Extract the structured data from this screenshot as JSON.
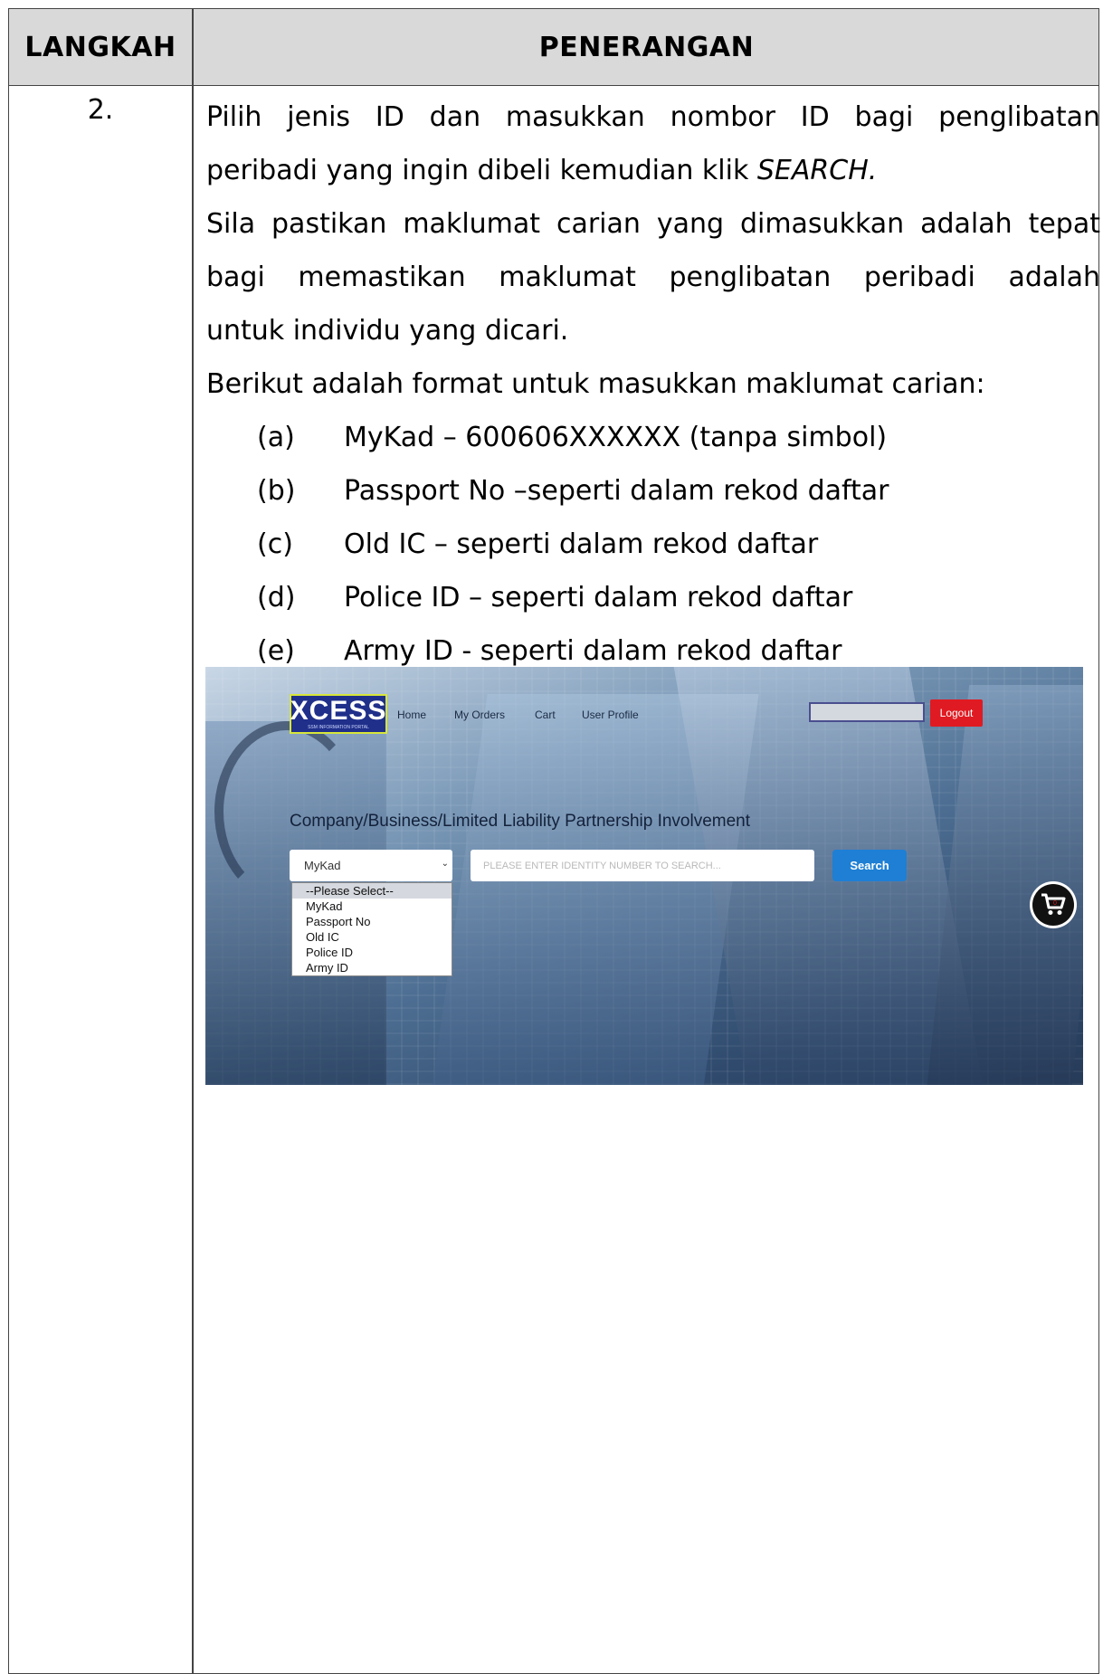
{
  "table": {
    "header": {
      "langkah": "LANGKAH",
      "penerangan": "PENERANGAN"
    },
    "step_number": "2.",
    "paragraphs": {
      "p1_line1": "Pilih jenis ID dan masukkan nombor ID bagi penglibatan",
      "p1_line2_prefix": "peribadi yang ingin dibeli kemudian klik ",
      "p1_line2_emph": "SEARCH.",
      "p2_line1": "Sila pastikan maklumat carian yang dimasukkan adalah tepat",
      "p2_line2": "bagi memastikan maklumat penglibatan peribadi adalah",
      "p2_line3": "untuk individu yang dicari.",
      "p3": "Berikut adalah format untuk masukkan maklumat carian:"
    },
    "list": [
      {
        "label": "(a)",
        "text": "MyKad – 600606XXXXXX (tanpa simbol)"
      },
      {
        "label": "(b)",
        "text": "Passport No –seperti dalam rekod daftar"
      },
      {
        "label": "(c)",
        "text": "Old IC – seperti dalam rekod daftar"
      },
      {
        "label": "(d)",
        "text": "Police ID – seperti dalam rekod daftar"
      },
      {
        "label": "(e)",
        "text": "Army ID - seperti dalam rekod daftar"
      }
    ]
  },
  "screenshot": {
    "logo": {
      "text": "XCESS",
      "subtext": "SSM INFORMATION PORTAL"
    },
    "nav": {
      "home": "Home",
      "orders": "My Orders",
      "cart": "Cart",
      "profile": "User Profile"
    },
    "logout_label": "Logout",
    "section_title": "Company/Business/Limited Liability Partnership Involvement",
    "id_type_selected": "MyKad",
    "search_placeholder": "PLEASE ENTER IDENTITY NUMBER TO SEARCH...",
    "search_label": "Search",
    "dropdown_options": [
      "--Please Select--",
      "MyKad",
      "Passport No",
      "Old IC",
      "Police ID",
      "Army ID"
    ],
    "cart_count": "0",
    "colors": {
      "logout": "#e01a22",
      "search": "#1e7fd4",
      "logo_bg": "#1f2f8a"
    },
    "icons": {
      "cart": "shopping-cart-icon",
      "select_arrow": "chevron-down-icon"
    }
  }
}
